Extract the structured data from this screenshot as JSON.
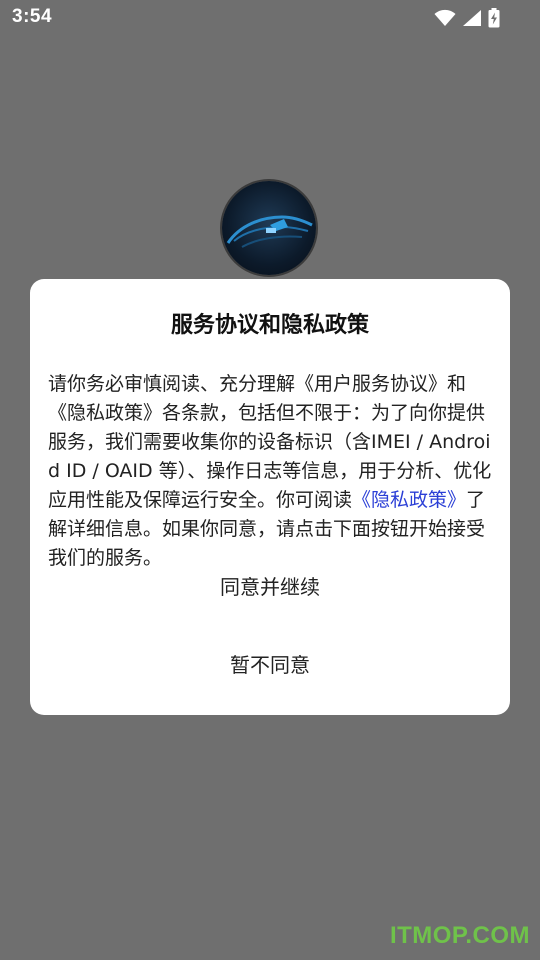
{
  "status_bar": {
    "time": "3:54",
    "icons": [
      "wifi-icon",
      "signal-icon",
      "battery-charging-icon"
    ]
  },
  "app": {
    "logo_icon": "car-logo-icon"
  },
  "dialog": {
    "title": "服务协议和隐私政策",
    "body_before_link": "请你务必审慎阅读、充分理解《用户服务协议》和《隐私政策》各条款，包括但不限于：为了向你提供服务，我们需要收集你的设备标识（含IMEI / Android ID / OAID 等）、操作日志等信息，用于分析、优化应用性能及保障运行安全。你可阅读",
    "link_text": "《隐私政策》",
    "body_after_link": "了解详细信息。如果你同意，请点击下面按钮开始接受我们的服务。",
    "agree_label": "同意并继续",
    "decline_label": "暂不同意"
  },
  "watermark": {
    "text": "ITMOP.COM"
  },
  "colors": {
    "overlay": "#6f6f6f",
    "dialog_bg": "#ffffff",
    "link": "#2b3fd6",
    "watermark": "#6fc24a"
  }
}
